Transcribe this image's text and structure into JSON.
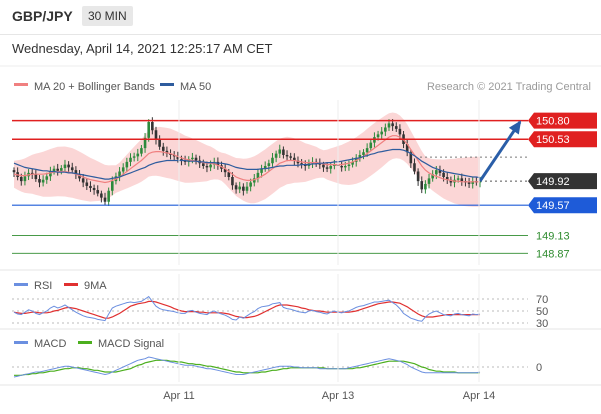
{
  "header": {
    "symbol": "GBP/JPY",
    "timeframe": "30 MIN",
    "datetime": "Wednesday, April 14, 2021 12:25:17 AM CET"
  },
  "copyright": "Research © 2021 Trading Central",
  "colors": {
    "resistance": "#e02020",
    "support": "#1e5bd8",
    "target": "#2e8b2e",
    "bollinger": "#f7b5b5",
    "ma20": "#f08080",
    "ma50": "#2e5c9e",
    "rsi": "#6b8fe0",
    "rsi_ma": "#e03030",
    "macd": "#6b8fe0",
    "macd_signal": "#4caf1e",
    "current": "#333333"
  },
  "chart_data": [
    {
      "type": "candlestick",
      "legend": [
        {
          "name": "MA 20 + Bollinger Bands",
          "color": "#f08080"
        },
        {
          "name": "MA 50",
          "color": "#2e5c9e"
        }
      ],
      "ylim": [
        148.7,
        151.1
      ],
      "x_labels": [
        "Apr 11",
        "Apr 13",
        "Apr 14"
      ],
      "levels": [
        {
          "label": "150.80",
          "value": 150.8,
          "kind": "resistance"
        },
        {
          "label": "150.53",
          "value": 150.53,
          "kind": "resistance"
        },
        {
          "label": "149.92",
          "value": 149.92,
          "kind": "current"
        },
        {
          "label": "149.57",
          "value": 149.57,
          "kind": "support"
        },
        {
          "label": "149.13",
          "value": 149.13,
          "kind": "target"
        },
        {
          "label": "148.87",
          "value": 148.87,
          "kind": "target"
        }
      ],
      "close": [
        150.05,
        149.98,
        149.92,
        149.99,
        150.04,
        150.02,
        149.95,
        149.9,
        149.94,
        149.99,
        150.06,
        150.1,
        150.07,
        150.11,
        150.16,
        150.12,
        150.08,
        150.02,
        149.96,
        149.9,
        149.85,
        149.82,
        149.79,
        149.74,
        149.68,
        149.62,
        149.78,
        149.92,
        149.99,
        150.06,
        150.12,
        150.2,
        150.26,
        150.28,
        150.32,
        150.4,
        150.55,
        150.78,
        150.66,
        150.52,
        150.42,
        150.36,
        150.32,
        150.3,
        150.28,
        150.24,
        150.22,
        150.2,
        150.24,
        150.26,
        150.22,
        150.18,
        150.14,
        150.12,
        150.16,
        150.2,
        150.15,
        150.1,
        150.05,
        149.98,
        149.86,
        149.8,
        149.84,
        149.78,
        149.84,
        149.9,
        149.96,
        150.04,
        150.1,
        150.14,
        150.18,
        150.26,
        150.32,
        150.38,
        150.3,
        150.28,
        150.26,
        150.22,
        150.18,
        150.16,
        150.14,
        150.18,
        150.2,
        150.18,
        150.16,
        150.12,
        150.1,
        150.14,
        150.16,
        150.14,
        150.12,
        150.14,
        150.16,
        150.2,
        150.26,
        150.3,
        150.34,
        150.4,
        150.48,
        150.56,
        150.6,
        150.64,
        150.7,
        150.76,
        150.72,
        150.68,
        150.6,
        150.46,
        150.34,
        150.18,
        150.06,
        149.92,
        149.8,
        149.88,
        149.96,
        150.02,
        150.08,
        150.04,
        149.98,
        149.94,
        149.9,
        149.94,
        149.96,
        149.92,
        149.9,
        149.88,
        149.92,
        149.9,
        149.92
      ],
      "ma20": [
        150.02,
        150.01,
        150.0,
        150.0,
        150.01,
        150.02,
        150.02,
        150.02,
        150.02,
        150.03,
        150.04,
        150.05,
        150.06,
        150.06,
        150.06,
        150.05,
        150.04,
        150.02,
        150.0,
        149.98,
        149.96,
        149.94,
        149.93,
        149.92,
        149.91,
        149.9,
        149.91,
        149.93,
        149.95,
        149.98,
        150.02,
        150.06,
        150.1,
        150.14,
        150.18,
        150.22,
        150.27,
        150.32,
        150.34,
        150.35,
        150.35,
        150.34,
        150.33,
        150.32,
        150.3,
        150.28,
        150.26,
        150.24,
        150.23,
        150.22,
        150.21,
        150.2,
        150.19,
        150.18,
        150.18,
        150.17,
        150.15,
        150.13,
        150.1,
        150.06,
        150.02,
        149.98,
        149.96,
        149.94,
        149.93,
        149.93,
        149.94,
        149.96,
        149.99,
        150.02,
        150.06,
        150.1,
        150.14,
        150.18,
        150.2,
        150.22,
        150.22,
        150.22,
        150.21,
        150.2,
        150.19,
        150.19,
        150.19,
        150.19,
        150.18,
        150.17,
        150.16,
        150.16,
        150.16,
        150.16,
        150.16,
        150.17,
        150.18,
        150.2,
        150.22,
        150.25,
        150.28,
        150.32,
        150.36,
        150.4,
        150.44,
        150.48,
        150.52,
        150.56,
        150.58,
        150.58,
        150.56,
        150.52,
        150.46,
        150.38,
        150.3,
        150.22,
        150.14,
        150.08,
        150.04,
        150.01,
        149.99,
        149.97,
        149.95,
        149.94,
        149.93,
        149.92,
        149.92,
        149.91,
        149.91,
        149.91,
        149.91,
        149.91,
        149.91
      ],
      "ma50": [
        150.18,
        150.16,
        150.14,
        150.12,
        150.11,
        150.1,
        150.09,
        150.08,
        150.07,
        150.07,
        150.06,
        150.06,
        150.05,
        150.05,
        150.05,
        150.04,
        150.04,
        150.03,
        150.02,
        150.01,
        150.0,
        149.99,
        149.98,
        149.97,
        149.96,
        149.95,
        149.95,
        149.96,
        149.97,
        149.98,
        150.0,
        150.02,
        150.04,
        150.06,
        150.08,
        150.1,
        150.12,
        150.15,
        150.17,
        150.19,
        150.2,
        150.21,
        150.22,
        150.22,
        150.22,
        150.22,
        150.22,
        150.22,
        150.21,
        150.21,
        150.21,
        150.2,
        150.2,
        150.19,
        150.19,
        150.19,
        150.18,
        150.18,
        150.17,
        150.16,
        150.14,
        150.12,
        150.11,
        150.1,
        150.09,
        150.09,
        150.09,
        150.09,
        150.1,
        150.1,
        150.11,
        150.12,
        150.13,
        150.14,
        150.14,
        150.15,
        150.15,
        150.15,
        150.15,
        150.16,
        150.16,
        150.16,
        150.17,
        150.17,
        150.18,
        150.18,
        150.19,
        150.19,
        150.2,
        150.2,
        150.21,
        150.22,
        150.23,
        150.24,
        150.25,
        150.26,
        150.28,
        150.29,
        150.31,
        150.32,
        150.34,
        150.35,
        150.36,
        150.37,
        150.38,
        150.38,
        150.38,
        150.37,
        150.35,
        150.32,
        150.29,
        150.25,
        150.21,
        150.18,
        150.15,
        150.12,
        150.1,
        150.08,
        150.06,
        150.05,
        150.04,
        150.03,
        150.02,
        150.01,
        150.0,
        149.99,
        149.98,
        149.98,
        149.97
      ],
      "bollinger_width": 0.28
    },
    {
      "type": "line",
      "legend": [
        {
          "name": "RSI",
          "color": "#6b8fe0"
        },
        {
          "name": "9MA",
          "color": "#e03030"
        }
      ],
      "ylim": [
        25,
        75
      ],
      "levels": [
        {
          "label": "70",
          "value": 70
        },
        {
          "label": "50",
          "value": 50
        },
        {
          "label": "30",
          "value": 30
        }
      ],
      "rsi": [
        48,
        45,
        44,
        48,
        52,
        50,
        46,
        44,
        47,
        50,
        55,
        58,
        55,
        57,
        60,
        56,
        52,
        48,
        45,
        42,
        40,
        39,
        38,
        36,
        35,
        34,
        45,
        55,
        58,
        60,
        62,
        64,
        65,
        64,
        65,
        66,
        70,
        74,
        66,
        58,
        54,
        52,
        51,
        50,
        49,
        47,
        46,
        46,
        50,
        51,
        48,
        46,
        45,
        44,
        48,
        50,
        47,
        45,
        43,
        40,
        36,
        35,
        40,
        38,
        42,
        46,
        49,
        54,
        57,
        58,
        59,
        62,
        63,
        64,
        56,
        54,
        53,
        51,
        49,
        48,
        47,
        50,
        51,
        49,
        48,
        46,
        45,
        48,
        50,
        48,
        47,
        49,
        50,
        53,
        56,
        58,
        59,
        61,
        63,
        65,
        65,
        66,
        67,
        68,
        64,
        60,
        54,
        46,
        42,
        38,
        36,
        34,
        33,
        40,
        45,
        48,
        50,
        47,
        44,
        43,
        42,
        45,
        46,
        44,
        43,
        42,
        45,
        44,
        45
      ],
      "rsi_ma": [
        48,
        47,
        46,
        46,
        47,
        48,
        48,
        47,
        47,
        47,
        48,
        50,
        51,
        53,
        55,
        56,
        55,
        54,
        52,
        50,
        48,
        46,
        44,
        42,
        40,
        38,
        38,
        40,
        43,
        46,
        50,
        54,
        58,
        60,
        62,
        63,
        64,
        66,
        66,
        65,
        63,
        61,
        59,
        57,
        54,
        52,
        50,
        49,
        49,
        49,
        49,
        48,
        48,
        47,
        47,
        47,
        47,
        47,
        46,
        45,
        43,
        41,
        40,
        39,
        39,
        40,
        41,
        43,
        46,
        49,
        52,
        55,
        58,
        60,
        60,
        60,
        59,
        58,
        57,
        55,
        54,
        52,
        51,
        50,
        50,
        49,
        48,
        48,
        48,
        48,
        48,
        48,
        48,
        49,
        50,
        52,
        54,
        56,
        58,
        60,
        62,
        63,
        64,
        65,
        65,
        64,
        63,
        60,
        57,
        53,
        49,
        45,
        42,
        40,
        40,
        40,
        41,
        42,
        43,
        44,
        44,
        44,
        44,
        44,
        44,
        44,
        44,
        44,
        44
      ]
    },
    {
      "type": "line",
      "legend": [
        {
          "name": "MACD",
          "color": "#6b8fe0"
        },
        {
          "name": "MACD Signal",
          "color": "#4caf1e"
        }
      ],
      "ylim": [
        -0.18,
        0.18
      ],
      "levels": [
        {
          "label": "0",
          "value": 0
        }
      ],
      "macd": [
        -0.12,
        -0.11,
        -0.1,
        -0.09,
        -0.08,
        -0.07,
        -0.06,
        -0.06,
        -0.05,
        -0.04,
        -0.03,
        -0.02,
        -0.01,
        0.0,
        0.01,
        0.01,
        0.0,
        -0.01,
        -0.02,
        -0.03,
        -0.04,
        -0.05,
        -0.06,
        -0.07,
        -0.08,
        -0.09,
        -0.08,
        -0.06,
        -0.04,
        -0.02,
        0.0,
        0.02,
        0.04,
        0.06,
        0.08,
        0.09,
        0.1,
        0.12,
        0.11,
        0.1,
        0.09,
        0.08,
        0.07,
        0.06,
        0.05,
        0.04,
        0.03,
        0.02,
        0.02,
        0.02,
        0.01,
        0.0,
        -0.01,
        -0.02,
        -0.02,
        -0.03,
        -0.04,
        -0.05,
        -0.06,
        -0.07,
        -0.08,
        -0.09,
        -0.09,
        -0.09,
        -0.08,
        -0.07,
        -0.06,
        -0.05,
        -0.04,
        -0.03,
        -0.02,
        -0.01,
        0.0,
        0.01,
        0.01,
        0.01,
        0.01,
        0.0,
        0.0,
        -0.01,
        -0.01,
        -0.01,
        -0.01,
        -0.01,
        -0.02,
        -0.02,
        -0.02,
        -0.02,
        -0.02,
        -0.02,
        -0.02,
        -0.02,
        -0.01,
        0.0,
        0.01,
        0.02,
        0.03,
        0.04,
        0.05,
        0.06,
        0.07,
        0.08,
        0.09,
        0.1,
        0.09,
        0.08,
        0.07,
        0.05,
        0.03,
        0.0,
        -0.02,
        -0.04,
        -0.06,
        -0.07,
        -0.07,
        -0.07,
        -0.07,
        -0.07,
        -0.07,
        -0.07,
        -0.07,
        -0.07,
        -0.07,
        -0.07,
        -0.07,
        -0.07,
        -0.07,
        -0.07,
        -0.06
      ],
      "macd_signal": [
        -0.1,
        -0.1,
        -0.1,
        -0.09,
        -0.09,
        -0.08,
        -0.08,
        -0.07,
        -0.07,
        -0.06,
        -0.05,
        -0.05,
        -0.04,
        -0.03,
        -0.02,
        -0.02,
        -0.01,
        -0.01,
        -0.01,
        -0.02,
        -0.02,
        -0.03,
        -0.04,
        -0.04,
        -0.05,
        -0.06,
        -0.06,
        -0.06,
        -0.06,
        -0.05,
        -0.04,
        -0.03,
        -0.02,
        0.0,
        0.02,
        0.03,
        0.05,
        0.06,
        0.07,
        0.08,
        0.08,
        0.08,
        0.08,
        0.07,
        0.07,
        0.06,
        0.06,
        0.05,
        0.04,
        0.04,
        0.03,
        0.03,
        0.02,
        0.01,
        0.01,
        0.0,
        -0.01,
        -0.02,
        -0.03,
        -0.04,
        -0.05,
        -0.06,
        -0.06,
        -0.07,
        -0.07,
        -0.07,
        -0.07,
        -0.07,
        -0.06,
        -0.06,
        -0.05,
        -0.04,
        -0.04,
        -0.03,
        -0.02,
        -0.02,
        -0.01,
        -0.01,
        -0.01,
        -0.01,
        -0.01,
        -0.01,
        -0.01,
        -0.01,
        -0.01,
        -0.01,
        -0.02,
        -0.02,
        -0.02,
        -0.02,
        -0.02,
        -0.02,
        -0.02,
        -0.02,
        -0.01,
        -0.01,
        0.0,
        0.01,
        0.02,
        0.03,
        0.04,
        0.05,
        0.06,
        0.07,
        0.07,
        0.07,
        0.07,
        0.07,
        0.06,
        0.05,
        0.04,
        0.02,
        0.0,
        -0.01,
        -0.03,
        -0.04,
        -0.05,
        -0.05,
        -0.06,
        -0.06,
        -0.06,
        -0.06,
        -0.07,
        -0.07,
        -0.07,
        -0.07,
        -0.07,
        -0.07,
        -0.07
      ]
    }
  ]
}
